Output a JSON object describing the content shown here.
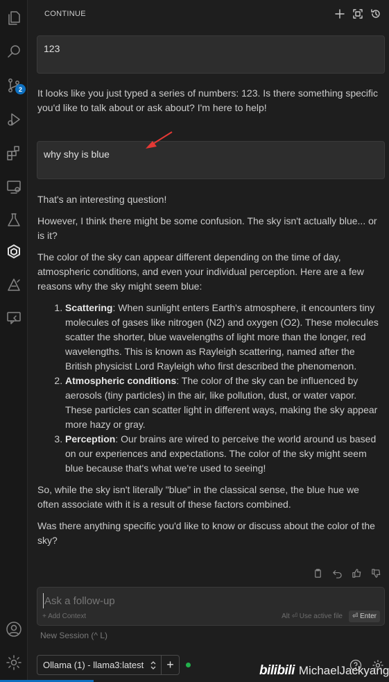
{
  "panel": {
    "title": "CONTINUE"
  },
  "activity_bar": {
    "items": [
      {
        "icon": "files-icon"
      },
      {
        "icon": "search-icon"
      },
      {
        "icon": "source-control-icon",
        "badge": "2"
      },
      {
        "icon": "run-debug-icon"
      },
      {
        "icon": "extensions-icon"
      },
      {
        "icon": "remote-explorer-icon"
      },
      {
        "icon": "testing-icon"
      },
      {
        "icon": "continue-icon"
      },
      {
        "icon": "ai-tool-icon"
      },
      {
        "icon": "chat-icon"
      }
    ],
    "bottom": [
      {
        "icon": "account-icon"
      },
      {
        "icon": "settings-gear-icon"
      }
    ]
  },
  "conversation": {
    "msg1": "123",
    "resp1": "It looks like you just typed a series of numbers: 123. Is there something specific you'd like to talk about or ask about? I'm here to help!",
    "msg2": "why shy is blue",
    "resp2": {
      "p1": "That's an interesting question!",
      "p2": "However, I think there might be some confusion. The sky isn't actually blue... or is it?",
      "p3": "The color of the sky can appear different depending on the time of day, atmospheric conditions, and even your individual perception. Here are a few reasons why the sky might seem blue:",
      "list": [
        {
          "term": "Scattering",
          "text": ": When sunlight enters Earth's atmosphere, it encounters tiny molecules of gases like nitrogen (N2) and oxygen (O2). These molecules scatter the shorter, blue wavelengths of light more than the longer, red wavelengths. This is known as Rayleigh scattering, named after the British physicist Lord Rayleigh who first described the phenomenon."
        },
        {
          "term": "Atmospheric conditions",
          "text": ": The color of the sky can be influenced by aerosols (tiny particles) in the air, like pollution, dust, or water vapor. These particles can scatter light in different ways, making the sky appear more hazy or gray."
        },
        {
          "term": "Perception",
          "text": ": Our brains are wired to perceive the world around us based on our experiences and expectations. The color of the sky might seem blue because that's what we're used to seeing!"
        }
      ],
      "p4": "So, while the sky isn't literally \"blue\" in the classical sense, the blue hue we often associate with it is a result of these factors combined.",
      "p5": "Was there anything specific you'd like to know or discuss about the color of the sky?"
    }
  },
  "input": {
    "placeholder": "Ask a follow-up",
    "add_context": "+ Add Context",
    "use_active_file": "Alt ⏎ Use active file",
    "enter": "⏎ Enter"
  },
  "new_session": "New Session (^ L)",
  "model": {
    "selected": "Ollama (1) - llama3:latest",
    "add": "+"
  },
  "watermark": {
    "logo": "bilibili",
    "name": "MichaelJackyang"
  },
  "colors": {
    "background": "#1e1e1e",
    "accent": "#0e70c0",
    "status_online": "#22b14c",
    "annotation_arrow": "#e53935"
  }
}
